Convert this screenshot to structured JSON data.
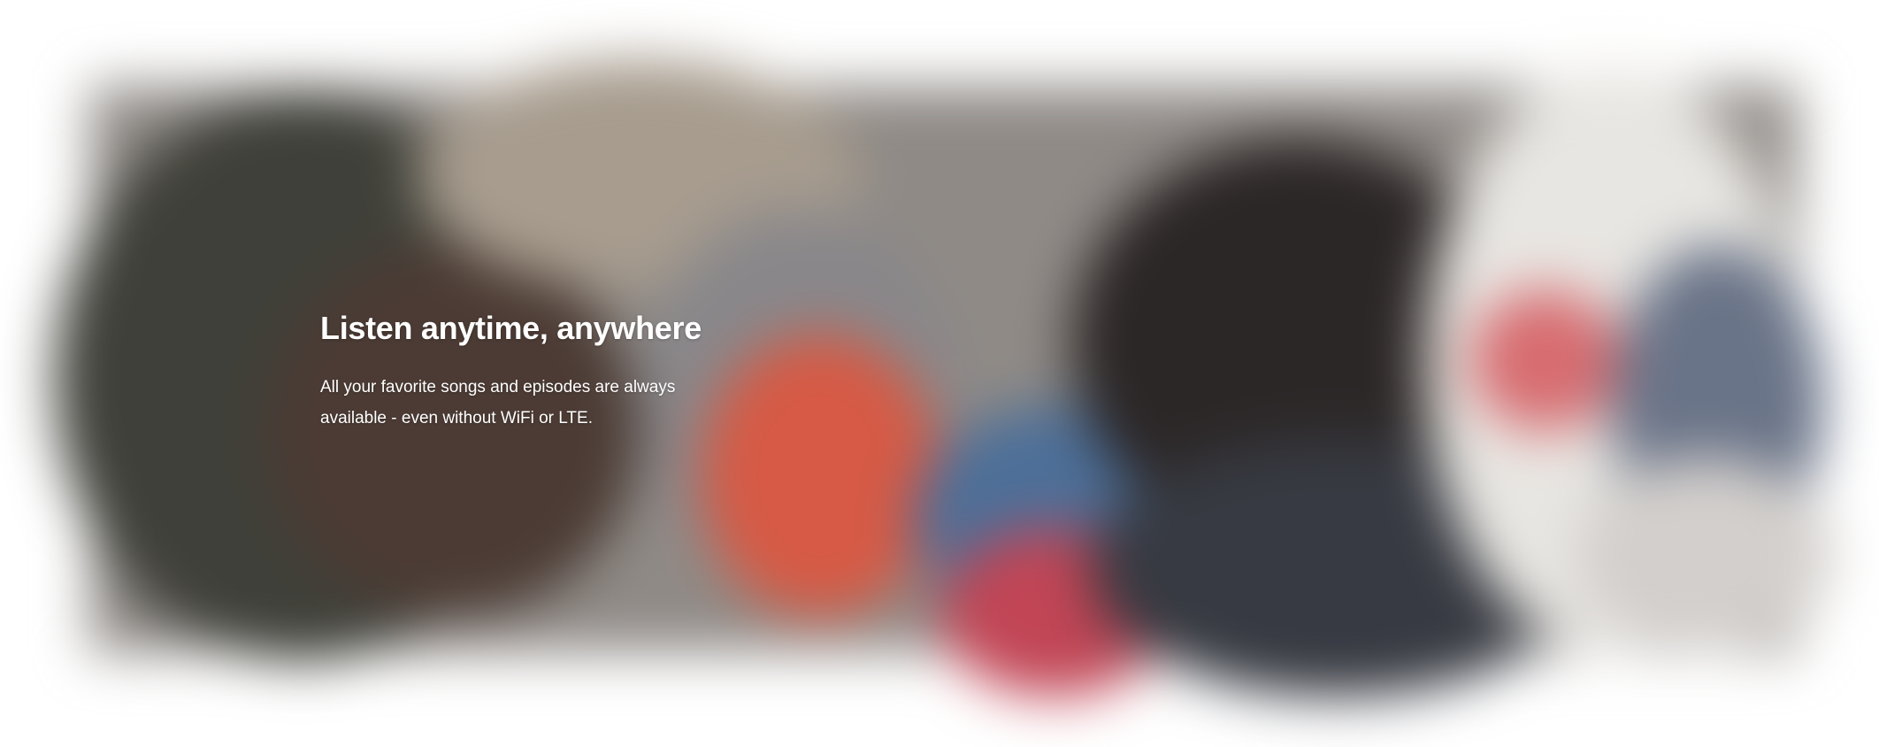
{
  "hero": {
    "title": "Listen anytime, anywhere",
    "description": "All your favorite songs and episodes are always available - even without WiFi or LTE."
  },
  "colors": {
    "background": "#ffffff",
    "text": "#ffffff",
    "accent_red": "#d65a45",
    "accent_blue": "#4d6f98"
  }
}
